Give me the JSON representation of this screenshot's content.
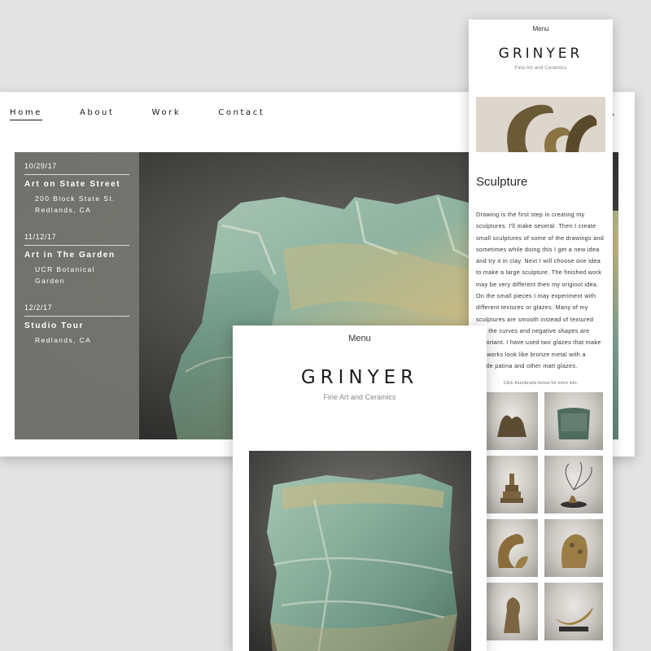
{
  "colors": {
    "page_bg": "#e3e3e3",
    "events_panel": "#767672",
    "ceramic_green": "#8fb3a2",
    "ceramic_tan": "#c9b982"
  },
  "desktop": {
    "nav": [
      {
        "label": "Home",
        "active": true
      },
      {
        "label": "About",
        "active": false
      },
      {
        "label": "Work",
        "active": false
      },
      {
        "label": "Contact",
        "active": false
      }
    ],
    "corner_letter": "R",
    "events": [
      {
        "date": "10/29/17",
        "title": "Art on State Street",
        "address": [
          "200 Block State St.",
          "Redlands, CA"
        ]
      },
      {
        "date": "11/12/17",
        "title": "Art in The Garden",
        "address": [
          "UCR Botanical",
          "Garden"
        ]
      },
      {
        "date": "12/2/17",
        "title": "Studio Tour",
        "address": [
          "Redlands, CA"
        ]
      }
    ]
  },
  "mobile_right": {
    "menu_label": "Menu",
    "logo": "GRINYER",
    "tagline": "Fine Art and Ceramics",
    "section_title": "Sculpture",
    "body": "Drawing is the first step in creating my sculptures. I'll make several. Then I create small sculptures of some of the drawings and sometimes while doing this I get a new idea and try it in clay. Next I will choose one idea to make a large sculpture. The finished work may be very different then my originol idea. On the small pieces I may experiment with different textures or glazes. Many of my sculptures are smooth instead of textured and the curves and negative shapes are important. I have used two glazes that make the works look like bronze metal with a subtle patina and other matt glazes.",
    "thumb_note": "Click thumbnails below for more info.",
    "thumbnails": [
      "basket-sculpture-icon",
      "green-vessel-icon",
      "stacked-vessel-icon",
      "wire-sculpture-icon",
      "curved-bronze-icon",
      "textured-figure-icon",
      "bird-figure-icon",
      "banana-sculpture-icon"
    ]
  },
  "mobile_center": {
    "menu_label": "Menu",
    "logo": "GRINYER",
    "tagline": "Fine Art and Ceramics"
  }
}
